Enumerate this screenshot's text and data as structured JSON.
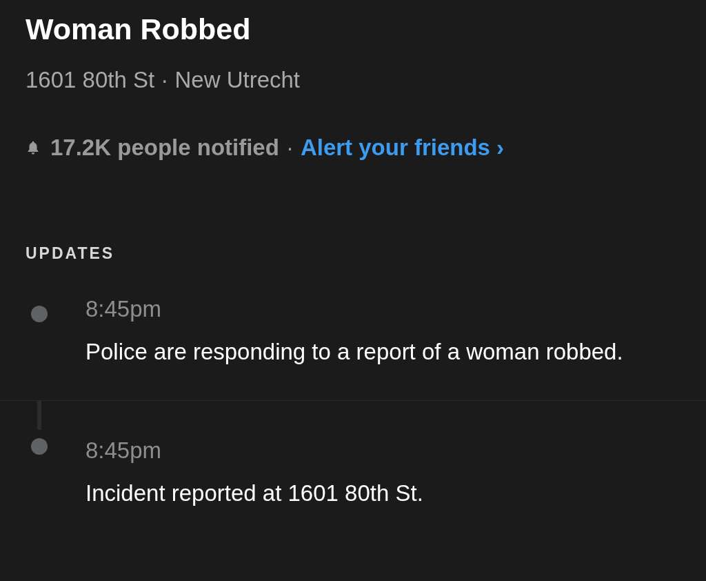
{
  "title": "Woman Robbed",
  "subtitle": "1601 80th St · New Utrecht",
  "notified": "17.2K people notified",
  "separator": "·",
  "alert_link": "Alert your friends ›",
  "updates_heading": "UPDATES",
  "updates": [
    {
      "time": "8:45pm",
      "text": "Police are responding to a report of a woman robbed."
    },
    {
      "time": "8:45pm",
      "text": "Incident reported at 1601 80th St."
    }
  ]
}
